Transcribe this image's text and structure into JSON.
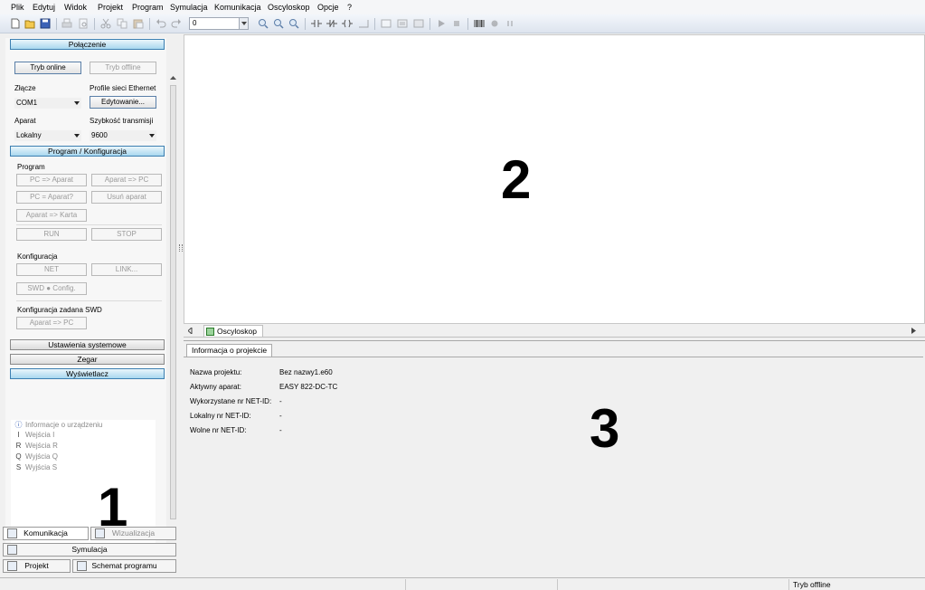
{
  "menu": [
    "Plik",
    "Edytuj",
    "Widok",
    "Projekt",
    "Program",
    "Symulacja",
    "Komunikacja",
    "Oscyloskop",
    "Opcje",
    "?"
  ],
  "toolbar": {
    "combo_value": "0"
  },
  "left": {
    "connection_header": "Połączenie",
    "online_button": "Tryb online",
    "offline_button": "Tryb offline",
    "port_label": "Złącze",
    "port_value": "COM1",
    "ethernet_label": "Profile sieci Ethernet",
    "edit_button": "Edytowanie...",
    "device_label": "Aparat",
    "device_value": "Lokalny",
    "baud_label": "Szybkość transmisji",
    "baud_value": "9600",
    "program_header": "Program / Konfiguracja",
    "program_group": "Program",
    "pc_to_device": "PC => Aparat",
    "device_to_pc": "Aparat => PC",
    "pc_eq_device": "PC = Aparat?",
    "delete_device": "Usuń aparat",
    "device_to_card": "Aparat => Karta",
    "run": "RUN",
    "stop": "STOP",
    "config_group": "Konfiguracja",
    "net": "NET",
    "link": "LINK...",
    "swd": "SWD  ● Config.",
    "swd_group": "Konfiguracja zadana SWD",
    "swd_device_to_pc": "Aparat => PC",
    "system_settings": "Ustawienia systemowe",
    "clock": "Zegar",
    "display": "Wyświetlacz",
    "tree": [
      {
        "icon": "ⓘ",
        "label": "Informacje o urządzeniu"
      },
      {
        "icon": "I",
        "label": "Wejścia I"
      },
      {
        "icon": "R",
        "label": "Wejścia R"
      },
      {
        "icon": "Q",
        "label": "Wyjścia Q"
      },
      {
        "icon": "S",
        "label": "Wyjścia S"
      }
    ],
    "tab_communication": "Komunikacja",
    "tab_visualization": "Wizualizacja",
    "tab_simulation": "Symulacja",
    "tab_project": "Projekt",
    "tab_schematic": "Schemat programu"
  },
  "markers": {
    "one": "1",
    "two": "2",
    "three": "3"
  },
  "oscilloscope": {
    "tab_label": "Oscyloskop"
  },
  "info": {
    "tab_label": "Informacja o projekcie",
    "rows": [
      {
        "key": "Nazwa projektu:",
        "value": "Bez nazwy1.e60"
      },
      {
        "key": "Aktywny aparat:",
        "value": "EASY 822-DC-TC"
      },
      {
        "key": "Wykorzystane nr NET-ID:",
        "value": "-"
      },
      {
        "key": "Lokalny nr NET-ID:",
        "value": "-"
      },
      {
        "key": "Wolne nr NET-ID:",
        "value": "-"
      }
    ]
  },
  "status": {
    "mode": "Tryb offline"
  }
}
